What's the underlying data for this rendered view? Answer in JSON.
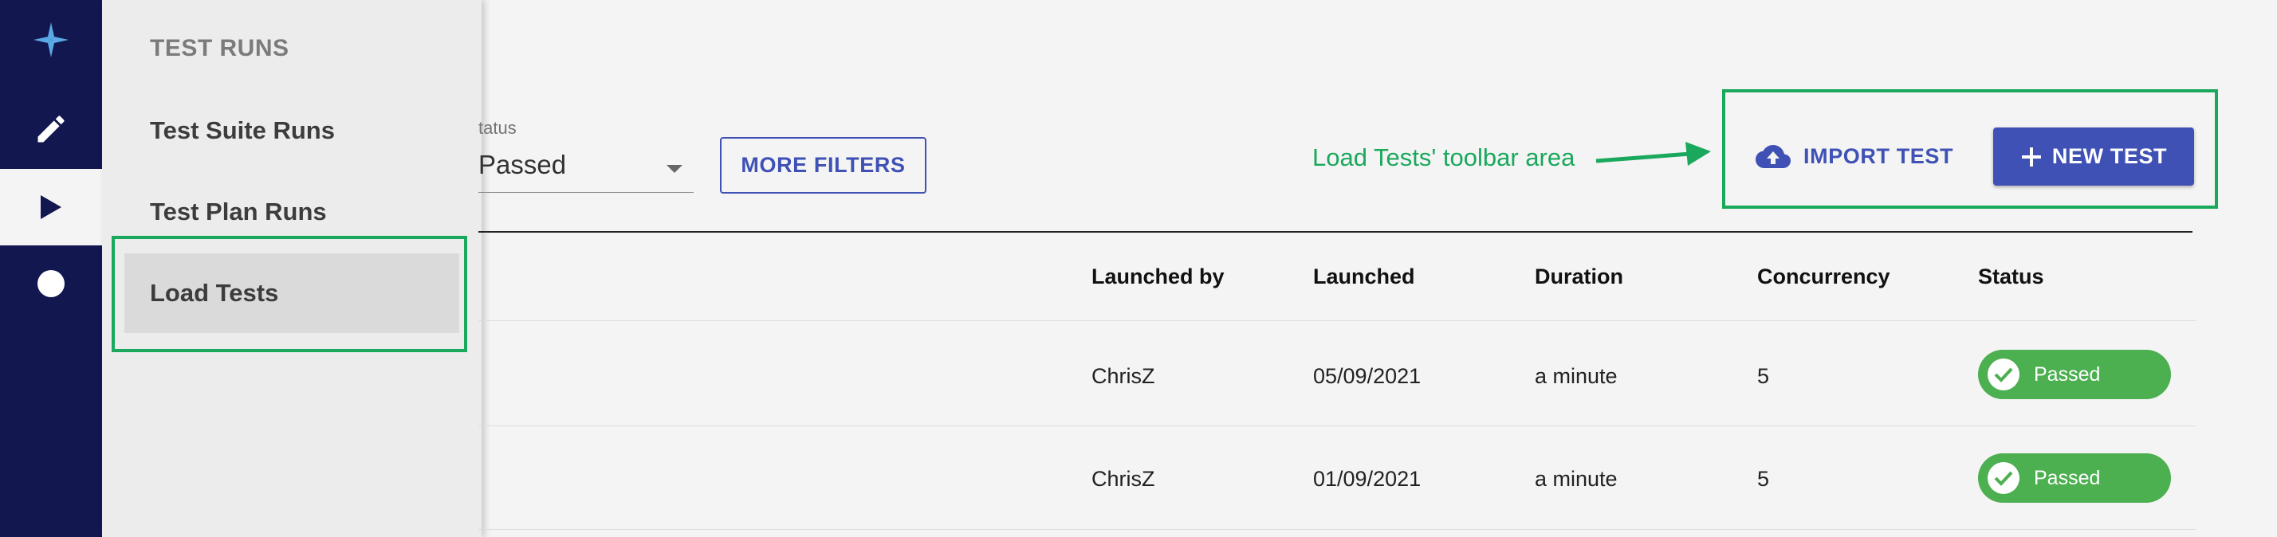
{
  "rail": {
    "items": [
      {
        "icon": "app-logo-icon"
      },
      {
        "icon": "pencil-icon"
      },
      {
        "icon": "play-icon"
      },
      {
        "icon": "circle-icon"
      }
    ],
    "active_index": 2
  },
  "nav": {
    "heading": "TEST RUNS",
    "items": [
      {
        "label": "Test Suite Runs"
      },
      {
        "label": "Test Plan Runs"
      },
      {
        "label": "Load Tests",
        "selected": true
      }
    ]
  },
  "filters": {
    "status_label": "tatus",
    "status_value": "Passed",
    "more_filters_label": "MORE FILTERS"
  },
  "toolbar": {
    "import_label": "IMPORT TEST",
    "new_label": "NEW TEST"
  },
  "annotation": {
    "text": "Load Tests' toolbar area",
    "color": "#1aa85c"
  },
  "table": {
    "columns": [
      "Launched by",
      "Launched",
      "Duration",
      "Concurrency",
      "Status"
    ],
    "rows": [
      {
        "launched_by": "ChrisZ",
        "launched": "05/09/2021",
        "duration": "a minute",
        "concurrency": "5",
        "status": "Passed"
      },
      {
        "launched_by": "ChrisZ",
        "launched": "01/09/2021",
        "duration": "a minute",
        "concurrency": "5",
        "status": "Passed"
      }
    ]
  },
  "colors": {
    "rail_bg": "#12174f",
    "primary": "#3f51b5",
    "status_passed": "#4caf50"
  }
}
